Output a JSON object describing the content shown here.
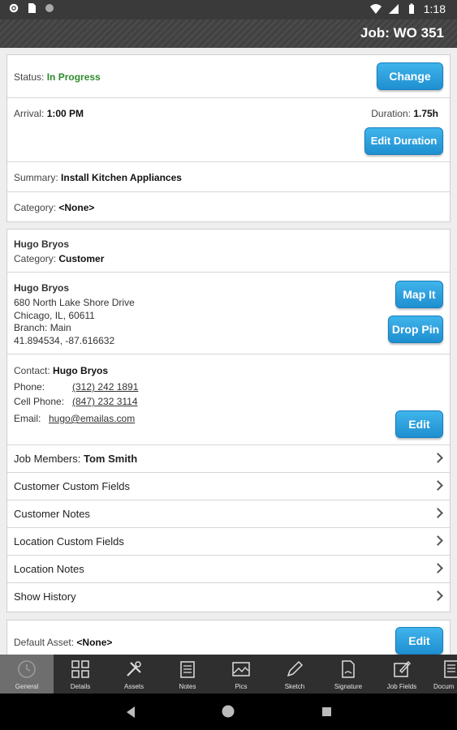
{
  "status_bar": {
    "time": "1:18"
  },
  "header": {
    "title": "Job: WO 351"
  },
  "job_card": {
    "status_label": "Status:",
    "status_value": "In Progress",
    "change_button": "Change",
    "arrival_label": "Arrival:",
    "arrival_value": "1:00 PM",
    "duration_label": "Duration:",
    "duration_value": "1.75h",
    "edit_duration_button": "Edit Duration",
    "summary_label": "Summary:",
    "summary_value": "Install Kitchen Appliances",
    "category_label": "Category:",
    "category_value": "<None>"
  },
  "customer_card": {
    "name": "Hugo Bryos",
    "category_label": "Category:",
    "category_value": "Customer",
    "location_name": "Hugo Bryos",
    "address_line1": "680 North Lake Shore Drive",
    "address_line2": "Chicago, IL, 60611",
    "branch": "Branch: Main",
    "coordinates": "41.894534, -87.616632",
    "map_button": "Map It",
    "drop_pin_button": "Drop Pin",
    "contact_label": "Contact:",
    "contact_value": "Hugo Bryos",
    "phone_label": "Phone:",
    "phone_value": "(312) 242 1891",
    "cell_label": "Cell Phone:",
    "cell_value": "(847) 232 3114",
    "email_label": "Email:",
    "email_value": "hugo@emailas.com",
    "edit_button": "Edit",
    "job_members_label": "Job Members:",
    "job_members_value": "Tom Smith",
    "rows": [
      "Customer Custom Fields",
      "Customer Notes",
      "Location Custom Fields",
      "Location Notes",
      "Show History"
    ]
  },
  "asset_card": {
    "label": "Default Asset:",
    "value": "<None>",
    "edit_button": "Edit"
  },
  "tabs": [
    {
      "label": "General",
      "icon": "clock-icon"
    },
    {
      "label": "Details",
      "icon": "grid-icon"
    },
    {
      "label": "Assets",
      "icon": "tools-icon"
    },
    {
      "label": "Notes",
      "icon": "notes-icon"
    },
    {
      "label": "Pics",
      "icon": "picture-icon"
    },
    {
      "label": "Sketch",
      "icon": "pencil-icon"
    },
    {
      "label": "Signature",
      "icon": "document-icon"
    },
    {
      "label": "Job Fields",
      "icon": "edit-icon"
    },
    {
      "label": "Docum",
      "icon": "documents-icon"
    }
  ],
  "colors": {
    "accent": "#2b8fd6",
    "status_green": "#2e8b2e",
    "tabbar": "#2f2f2f"
  }
}
